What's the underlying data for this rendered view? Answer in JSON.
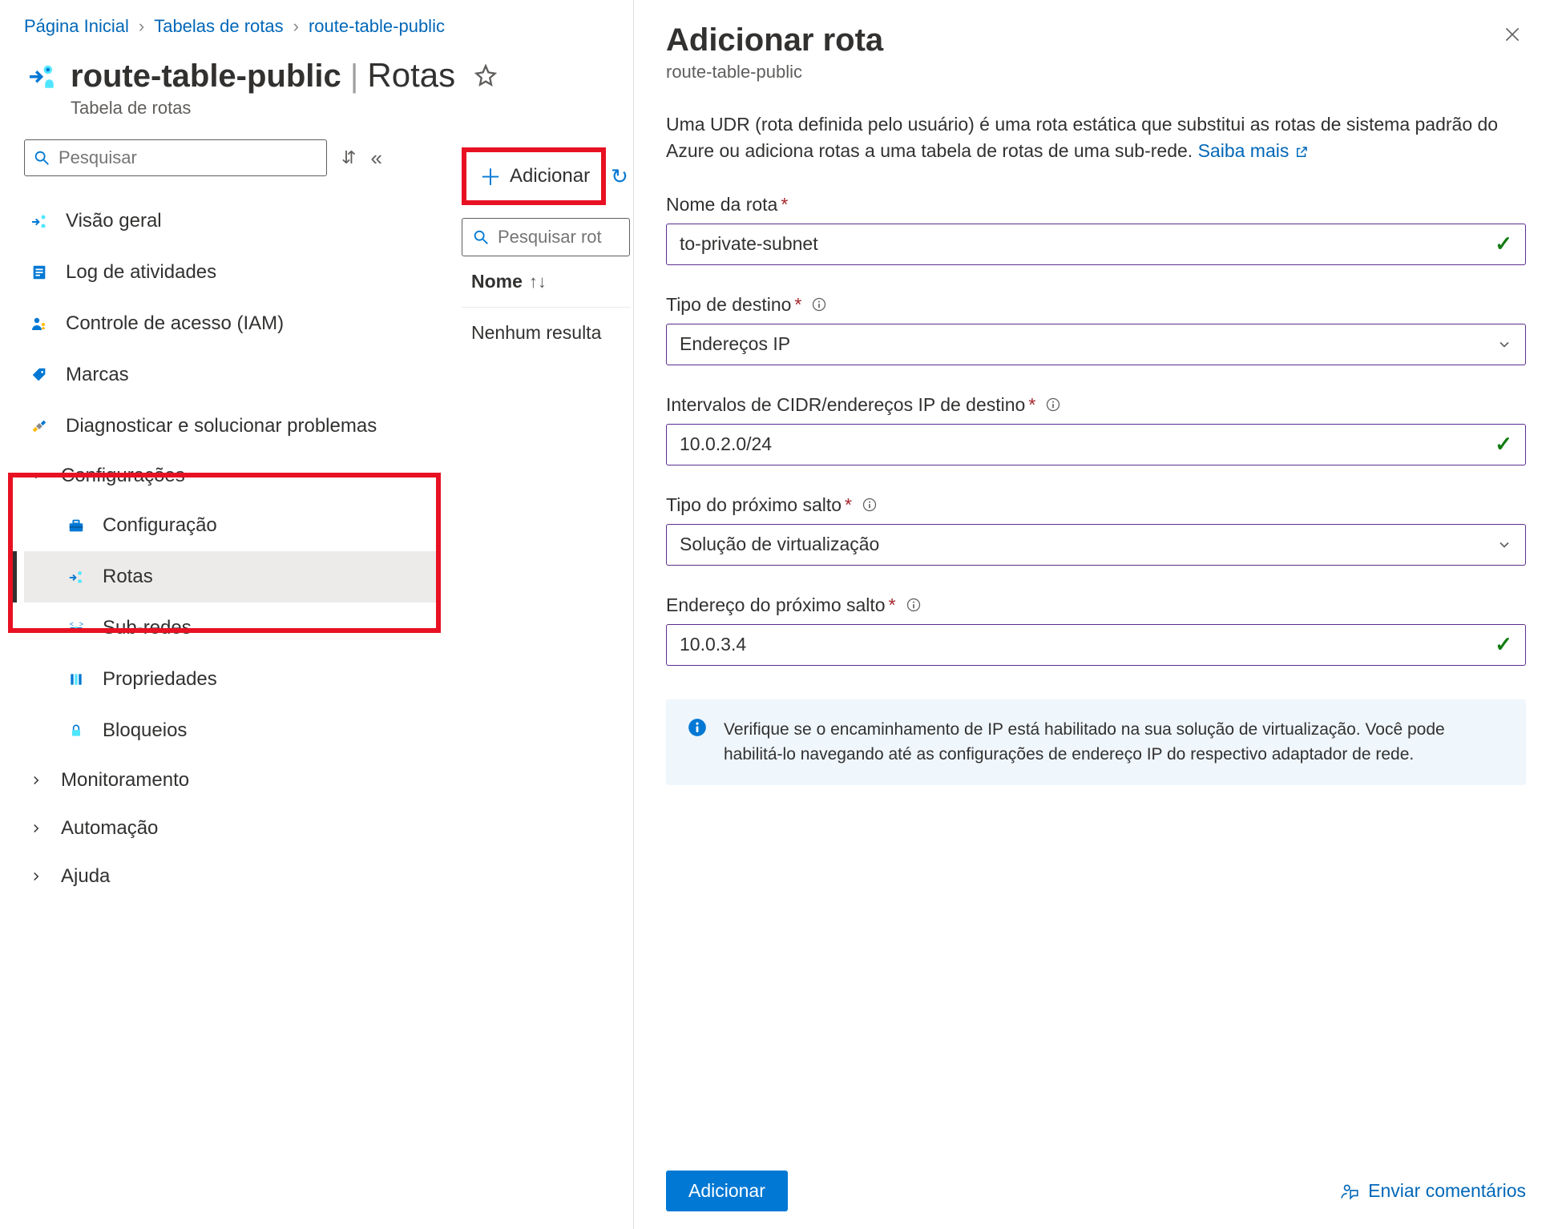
{
  "breadcrumbs": [
    "Página Inicial",
    "Tabelas de rotas",
    "route-table-public"
  ],
  "resource": {
    "name": "route-table-public",
    "section": "Rotas",
    "type_label": "Tabela de rotas"
  },
  "sidebar": {
    "search_placeholder": "Pesquisar",
    "items": [
      {
        "label": "Visão geral",
        "icon": "route-table-icon"
      },
      {
        "label": "Log de atividades",
        "icon": "log-icon"
      },
      {
        "label": "Controle de acesso (IAM)",
        "icon": "iam-icon"
      },
      {
        "label": "Marcas",
        "icon": "tag-icon"
      },
      {
        "label": "Diagnosticar e solucionar problemas",
        "icon": "diagnose-icon"
      }
    ],
    "groups": [
      {
        "label": "Configurações",
        "expanded": true,
        "children": [
          {
            "label": "Configuração",
            "icon": "toolbox-icon",
            "selected": false
          },
          {
            "label": "Rotas",
            "icon": "routes-icon",
            "selected": true
          },
          {
            "label": "Sub-redes",
            "icon": "subnets-icon",
            "selected": false
          },
          {
            "label": "Propriedades",
            "icon": "properties-icon",
            "selected": false
          },
          {
            "label": "Bloqueios",
            "icon": "locks-icon",
            "selected": false
          }
        ]
      },
      {
        "label": "Monitoramento",
        "expanded": false,
        "children": []
      },
      {
        "label": "Automação",
        "expanded": false,
        "children": []
      },
      {
        "label": "Ajuda",
        "expanded": false,
        "children": []
      }
    ]
  },
  "toolbar": {
    "add_label": "Adicionar"
  },
  "table": {
    "search_placeholder": "Pesquisar rot",
    "column_name": "Nome",
    "empty_text": "Nenhum resulta"
  },
  "panel": {
    "title": "Adicionar rota",
    "subtitle": "route-table-public",
    "description": "Uma UDR (rota definida pelo usuário) é uma rota estática que substitui as rotas de sistema padrão do Azure ou adiciona rotas a uma tabela de rotas de uma sub-rede.",
    "learn_more": "Saiba mais",
    "fields": {
      "route_name": {
        "label": "Nome da rota",
        "value": "to-private-subnet"
      },
      "dest_type": {
        "label": "Tipo de destino",
        "value": "Endereços IP"
      },
      "cidr": {
        "label": "Intervalos de CIDR/endereços IP de destino",
        "value": "10.0.2.0/24"
      },
      "hop_type": {
        "label": "Tipo do próximo salto",
        "value": "Solução de virtualização"
      },
      "hop_addr": {
        "label": "Endereço do próximo salto",
        "value": "10.0.3.4"
      }
    },
    "info_text": "Verifique se o encaminhamento de IP está habilitado na sua solução de virtualização. Você pode habilitá-lo navegando até as configurações de endereço IP do respectivo adaptador de rede.",
    "submit_label": "Adicionar",
    "feedback_label": "Enviar comentários"
  },
  "colors": {
    "link": "#0067b8",
    "primary": "#0078d4",
    "accent_border": "#5b2e91",
    "highlight": "#e81123",
    "success": "#107c10"
  }
}
